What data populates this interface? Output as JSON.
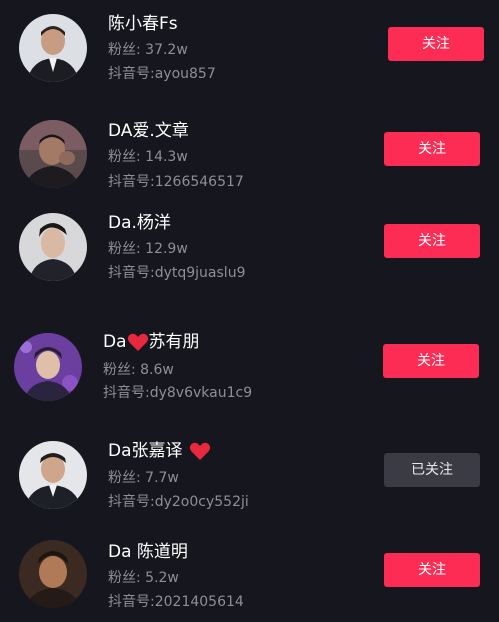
{
  "users": [
    {
      "name": "陈小春Fs",
      "fans_label": "粉丝: 37.2w",
      "id_label": "抖音号:ayou857",
      "button_label": "关注",
      "followed": false
    },
    {
      "name": "DA爱.文章",
      "fans_label": "粉丝: 14.3w",
      "id_label": "抖音号:1266546517",
      "button_label": "关注",
      "followed": false
    },
    {
      "name": "Da.杨洋",
      "fans_label": "粉丝: 12.9w",
      "id_label": "抖音号:dytq9juaslu9",
      "button_label": "关注",
      "followed": false
    },
    {
      "name_prefix": "Da",
      "name_suffix": "苏有朋",
      "fans_label": "粉丝: 8.6w",
      "id_label": "抖音号:dy8v6vkau1c9",
      "button_label": "关注",
      "followed": false
    },
    {
      "name": "Da张嘉译",
      "fans_label": "粉丝: 7.7w",
      "id_label": "抖音号:dy2o0cy552ji",
      "button_label": "已关注",
      "followed": true
    },
    {
      "name": "Da 陈道明",
      "fans_label": "粉丝: 5.2w",
      "id_label": "抖音号:2021405614",
      "button_label": "关注",
      "followed": false
    }
  ],
  "colors": {
    "background": "#16171e",
    "follow_button": "#fd2c55",
    "followed_button": "#3a3b44",
    "secondary_text": "#8d8e96",
    "heart": "#e8283c"
  },
  "icons": {
    "heart": "red-heart-icon"
  }
}
